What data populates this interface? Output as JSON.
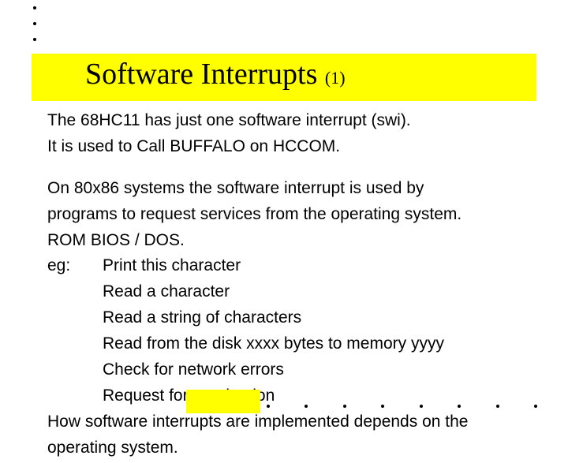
{
  "title": {
    "main": "Software Interrupts ",
    "sub": "(1)"
  },
  "para1_line1": "The 68HC11 has just one software interrupt (swi).",
  "para1_line2": "It is used to Call BUFFALO on HCCOM.",
  "para2_line1": "On 80x86 systems the software interrupt is used by",
  "para2_line2": "programs to request services from the operating system.",
  "para2_line3": "ROM BIOS / DOS.",
  "eg_label": "eg:       Print this character",
  "eg_items": {
    "i1": "            Read a character",
    "i2": "            Read a string of characters",
    "i3": "            Read from the disk xxxx bytes to memory yyyy",
    "i4": "            Check for network errors",
    "i5": "            Request for termination"
  },
  "closing_line1": "How software interrupts are implemented depends on the",
  "closing_line2": "operating system."
}
